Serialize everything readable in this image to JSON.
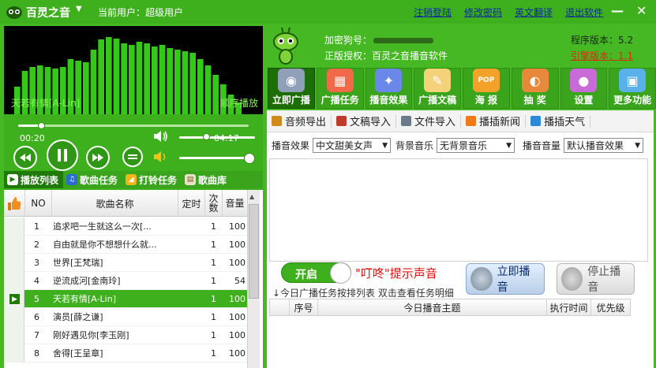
{
  "title": {
    "app": "百灵之音",
    "dropdown_symbol": "▼",
    "current_user": "当前用户：超级用户"
  },
  "top_links": [
    "注销登陆",
    "修改密码",
    "英文翻译",
    "退出软件"
  ],
  "window_buttons": {
    "minimize": "—",
    "close": "✕"
  },
  "player": {
    "now_playing": "天若有情[A-Lin]",
    "play_mode": "顺序播放",
    "time_current": "00:20",
    "time_total": "04:17",
    "progress": 0.1,
    "volume": 0.35,
    "spectrum_levels": [
      0.35,
      0.55,
      0.6,
      0.62,
      0.6,
      0.58,
      0.6,
      0.7,
      0.68,
      0.66,
      0.82,
      0.95,
      0.98,
      0.96,
      0.9,
      0.88,
      0.92,
      0.9,
      0.86,
      0.88,
      0.84,
      0.82,
      0.8,
      0.78,
      0.7,
      0.62,
      0.5,
      0.38,
      0.25,
      0.15
    ]
  },
  "tabs": [
    {
      "label": "播放列表",
      "icon": "play-circle-icon",
      "active": true
    },
    {
      "label": "歌曲任务",
      "icon": "music-note-icon",
      "active": false
    },
    {
      "label": "打铃任务",
      "icon": "bell-icon",
      "active": false
    },
    {
      "label": "歌曲库",
      "icon": "library-icon",
      "active": false
    }
  ],
  "playlist": {
    "headers": {
      "no": "NO",
      "name": "歌曲名称",
      "timed": "定时",
      "count": "次数",
      "volume": "音量"
    },
    "rows": [
      {
        "no": "1",
        "name": "追求吧一生就这么一次[...",
        "count": "1",
        "volume": "100",
        "selected": false
      },
      {
        "no": "2",
        "name": "自由就是你不想想什么就...",
        "count": "1",
        "volume": "100",
        "selected": false
      },
      {
        "no": "3",
        "name": "世界[王梵瑞]",
        "count": "1",
        "volume": "100",
        "selected": false
      },
      {
        "no": "4",
        "name": "逆流成河[金南玲]",
        "count": "1",
        "volume": "54",
        "selected": false
      },
      {
        "no": "5",
        "name": "天若有情[A-Lin]",
        "count": "1",
        "volume": "100",
        "selected": true
      },
      {
        "no": "6",
        "name": "演员[薛之谦]",
        "count": "1",
        "volume": "100",
        "selected": false
      },
      {
        "no": "7",
        "name": "刚好遇见你[李玉刚]",
        "count": "1",
        "volume": "100",
        "selected": false
      },
      {
        "no": "8",
        "name": "舍得[王呈章]",
        "count": "1",
        "volume": "100",
        "selected": false
      }
    ]
  },
  "info": {
    "dongle_label": "加密狗号：",
    "license": "正版授权：百灵之音播音软件",
    "version": "程序版本：5.2",
    "engine_version": "引擎版本：1.1"
  },
  "toolbar": [
    {
      "label": "立即广播",
      "icon": "speaker-icon",
      "active": true
    },
    {
      "label": "广播任务",
      "icon": "calendar-icon",
      "active": false
    },
    {
      "label": "播音效果",
      "icon": "effects-icon",
      "active": false
    },
    {
      "label": "广播文稿",
      "icon": "document-icon",
      "active": false
    },
    {
      "label": "海 报",
      "icon": "poster-icon",
      "active": false
    },
    {
      "label": "抽 奖",
      "icon": "lottery-icon",
      "active": false
    },
    {
      "label": "设置",
      "icon": "settings-icon",
      "active": false
    },
    {
      "label": "更多功能",
      "icon": "more-icon",
      "active": false
    }
  ],
  "subtoolbar": [
    {
      "label": "音频导出",
      "icon": "audio-export-icon"
    },
    {
      "label": "文稿导入",
      "icon": "doc-import-icon"
    },
    {
      "label": "文件导入",
      "icon": "file-import-icon"
    },
    {
      "label": "播插新闻",
      "icon": "rss-icon"
    },
    {
      "label": "播插天气",
      "icon": "weather-icon"
    }
  ],
  "broadcast_settings": {
    "effect_label": "播音效果",
    "effect_value": "中文甜美女声",
    "bgm_label": "背景音乐",
    "bgm_value": "无背景音乐",
    "volume_label": "播音音量",
    "volume_value": "默认播音效果",
    "dropdown_arrow": "▼"
  },
  "controls": {
    "toggle_label": "开启",
    "beep_text": "\"叮咚\"提示声音",
    "hint": "↓今日广播任务按排列表 双击查看任务明细",
    "play_now": "立即播音",
    "stop": "停止播音"
  },
  "task_table": {
    "headers": {
      "no": "序号",
      "subject": "今日播音主题",
      "time": "执行时间",
      "priority": "优先级"
    }
  },
  "colors": {
    "brand_green": "#45b823",
    "active_tab": "#1f7a0a",
    "link_blue": "#0a2a9a",
    "alert_red": "#e01010"
  }
}
